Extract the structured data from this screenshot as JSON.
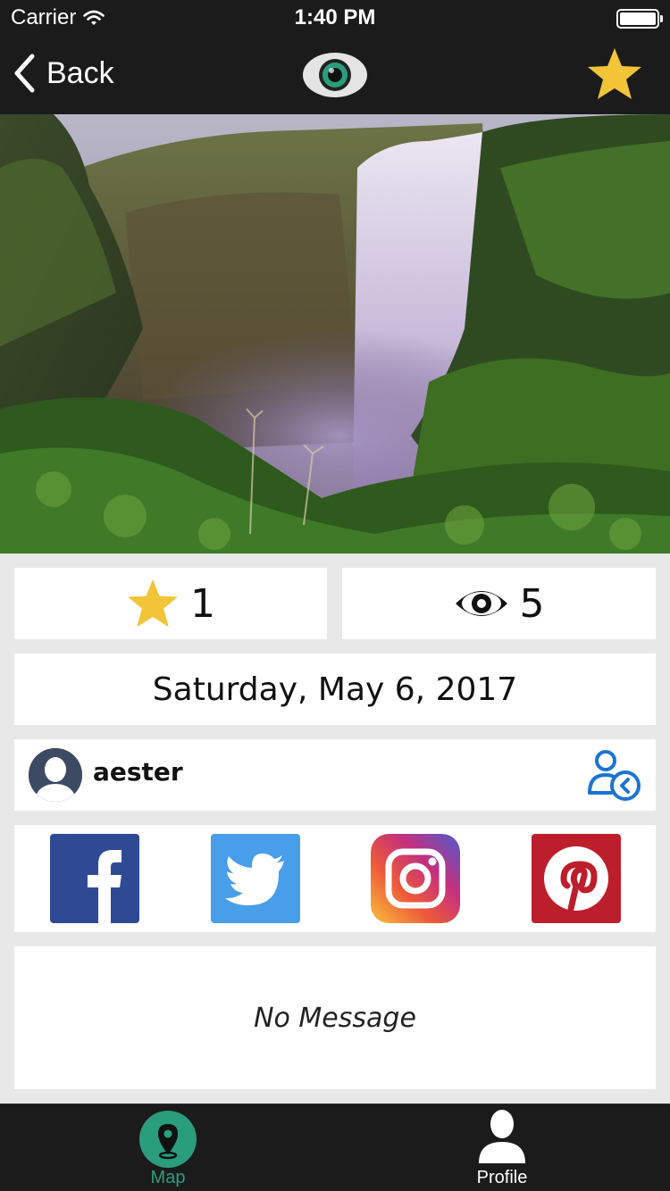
{
  "status": {
    "carrier": "Carrier",
    "time": "1:40 PM"
  },
  "nav": {
    "back_label": "Back"
  },
  "stats": {
    "stars": "1",
    "views": "5"
  },
  "date": "Saturday, May 6, 2017",
  "user": {
    "name": "aester"
  },
  "social": [
    "facebook",
    "twitter",
    "instagram",
    "pinterest"
  ],
  "message": "No Message",
  "tabs": [
    {
      "label": "Map",
      "active": true
    },
    {
      "label": "Profile",
      "active": false
    }
  ],
  "colors": {
    "accent_teal": "#2a9d7d",
    "star_yellow": "#f2c438",
    "follow_blue": "#1d73d1",
    "facebook": "#2f4a95",
    "twitter": "#489ee8",
    "pinterest": "#bd1e2c",
    "bar_dark": "#1b1b1b"
  }
}
